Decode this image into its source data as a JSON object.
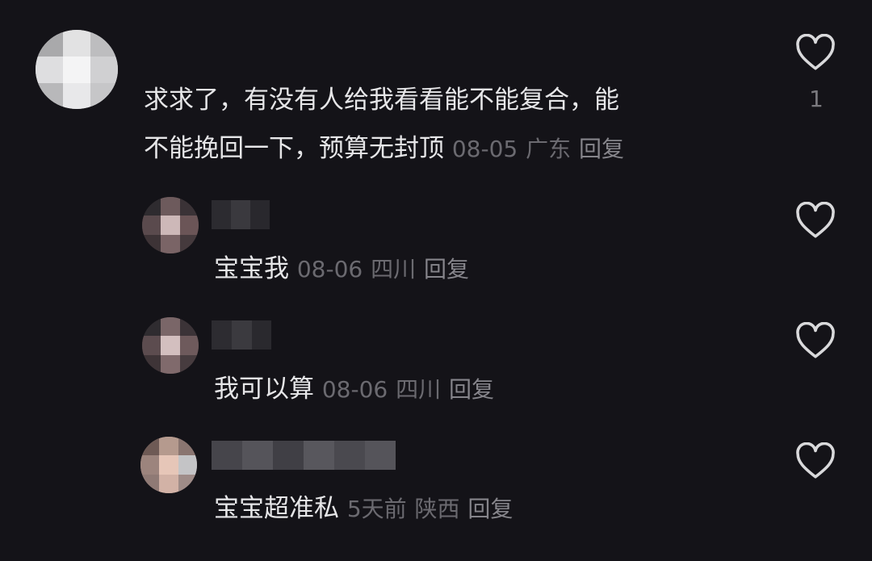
{
  "colors": {
    "background": "#141318",
    "text": "#e6e6e8",
    "meta": "#6b6a70",
    "reply": "#86858b"
  },
  "comment": {
    "text_line1": "求求了，有没有人给我看看能不能复合，能",
    "text_line2": "不能挽回一下，预算无封顶",
    "date": "08-05",
    "location": "广东",
    "reply_label": "回复",
    "like_icon": "heart-outline-icon",
    "like_count": "1"
  },
  "replies": [
    {
      "text": "宝宝我",
      "date": "08-06",
      "location": "四川",
      "reply_label": "回复",
      "like_icon": "heart-outline-icon"
    },
    {
      "text": "我可以算",
      "date": "08-06",
      "location": "四川",
      "reply_label": "回复",
      "like_icon": "heart-outline-icon"
    },
    {
      "text": "宝宝超准私",
      "date": "5天前",
      "location": "陕西",
      "reply_label": "回复",
      "like_icon": "heart-outline-icon"
    }
  ]
}
